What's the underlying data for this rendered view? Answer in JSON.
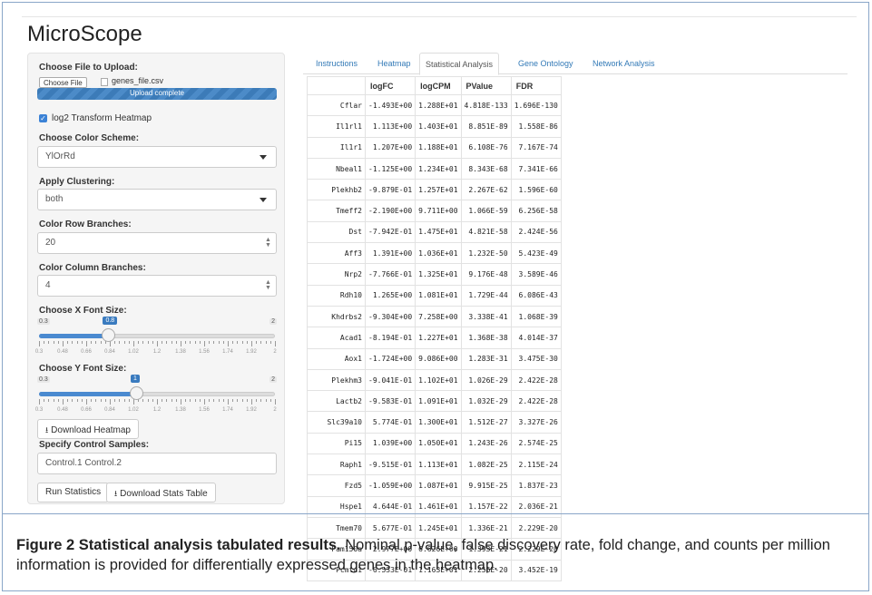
{
  "app": {
    "title": "MicroScope"
  },
  "sidebar": {
    "upload_label": "Choose File to Upload:",
    "choose_file_btn": "Choose File",
    "file_name": "genes_file.csv",
    "upload_status": "Upload complete",
    "upload_progress_pct": 100,
    "log2_label": "log2 Transform Heatmap",
    "log2_checked": true,
    "color_scheme_label": "Choose Color Scheme:",
    "color_scheme_value": "YlOrRd",
    "clustering_label": "Apply Clustering:",
    "clustering_value": "both",
    "row_branches_label": "Color Row Branches:",
    "row_branches_value": "20",
    "col_branches_label": "Color Column Branches:",
    "col_branches_value": "4",
    "x_font_label": "Choose X Font Size:",
    "x_slider": {
      "min": "0.3",
      "max": "2",
      "value": "0.8",
      "value_num": 0.8,
      "min_num": 0.3,
      "max_num": 2
    },
    "y_font_label": "Choose Y Font Size:",
    "y_slider": {
      "min": "0.3",
      "max": "2",
      "value": "1",
      "value_num": 1,
      "min_num": 0.3,
      "max_num": 2
    },
    "slider_grid": [
      "0.3",
      "0.48",
      "0.66",
      "0.84",
      "1.02",
      "1.2",
      "1.38",
      "1.56",
      "1.74",
      "1.92",
      "2"
    ],
    "download_heatmap": "Download Heatmap",
    "control_label": "Specify Control Samples:",
    "control_value": "Control.1  Control.2",
    "run_stats": "Run Statistics",
    "download_stats": "Download Stats Table"
  },
  "tabs": [
    "Instructions",
    "Heatmap",
    "Statistical Analysis",
    "Gene Ontology",
    "Network Analysis"
  ],
  "active_tab": "Statistical Analysis",
  "table": {
    "columns": [
      "",
      "logFC",
      "logCPM",
      "PValue",
      "FDR"
    ],
    "rows": [
      [
        "Cflar",
        "-1.493E+00",
        "1.288E+01",
        "4.818E-133",
        "1.696E-130"
      ],
      [
        "Il1rl1",
        "1.113E+00",
        "1.403E+01",
        "8.851E-89",
        "1.558E-86"
      ],
      [
        "Il1r1",
        "1.207E+00",
        "1.188E+01",
        "6.108E-76",
        "7.167E-74"
      ],
      [
        "Nbeal1",
        "-1.125E+00",
        "1.234E+01",
        "8.343E-68",
        "7.341E-66"
      ],
      [
        "Plekhb2",
        "-9.879E-01",
        "1.257E+01",
        "2.267E-62",
        "1.596E-60"
      ],
      [
        "Tmeff2",
        "-2.190E+00",
        "9.711E+00",
        "1.066E-59",
        "6.256E-58"
      ],
      [
        "Dst",
        "-7.942E-01",
        "1.475E+01",
        "4.821E-58",
        "2.424E-56"
      ],
      [
        "Aff3",
        "1.391E+00",
        "1.036E+01",
        "1.232E-50",
        "5.423E-49"
      ],
      [
        "Nrp2",
        "-7.766E-01",
        "1.325E+01",
        "9.176E-48",
        "3.589E-46"
      ],
      [
        "Rdh10",
        "1.265E+00",
        "1.081E+01",
        "1.729E-44",
        "6.086E-43"
      ],
      [
        "Khdrbs2",
        "-9.304E+00",
        "7.258E+00",
        "3.338E-41",
        "1.068E-39"
      ],
      [
        "Acad1",
        "-8.194E-01",
        "1.227E+01",
        "1.368E-38",
        "4.014E-37"
      ],
      [
        "Aox1",
        "-1.724E+00",
        "9.086E+00",
        "1.283E-31",
        "3.475E-30"
      ],
      [
        "Plekhm3",
        "-9.041E-01",
        "1.102E+01",
        "1.026E-29",
        "2.422E-28"
      ],
      [
        "Lactb2",
        "-9.583E-01",
        "1.091E+01",
        "1.032E-29",
        "2.422E-28"
      ],
      [
        "Slc39a10",
        "5.774E-01",
        "1.300E+01",
        "1.512E-27",
        "3.327E-26"
      ],
      [
        "Pi15",
        "1.039E+00",
        "1.050E+01",
        "1.243E-26",
        "2.574E-25"
      ],
      [
        "Raph1",
        "-9.515E-01",
        "1.113E+01",
        "1.082E-25",
        "2.115E-24"
      ],
      [
        "Fzd5",
        "-1.059E+00",
        "1.087E+01",
        "9.915E-25",
        "1.837E-23"
      ],
      [
        "Hspe1",
        "4.644E-01",
        "1.461E+01",
        "1.157E-22",
        "2.036E-21"
      ],
      [
        "Tmem70",
        "5.677E-01",
        "1.245E+01",
        "1.336E-21",
        "2.229E-20"
      ],
      [
        "Fam150a",
        "2.977E+00",
        "6.626E+00",
        "1.393E-21",
        "2.229E-20"
      ],
      [
        "Pcmtd1",
        "-6.533E-01",
        "1.163E+01",
        "2.256E-20",
        "3.452E-19"
      ]
    ]
  },
  "caption": {
    "label": "Figure 2",
    "title": "Statistical analysis tabulated results.",
    "text": "Nominal p-value, false discovery rate, fold change, and counts per million information is provided for differentially expressed genes in the heatmap."
  },
  "colors": {
    "accent": "#337ab7",
    "slider_fill": "#4a8ad0",
    "progress": "#3c7bb8"
  }
}
